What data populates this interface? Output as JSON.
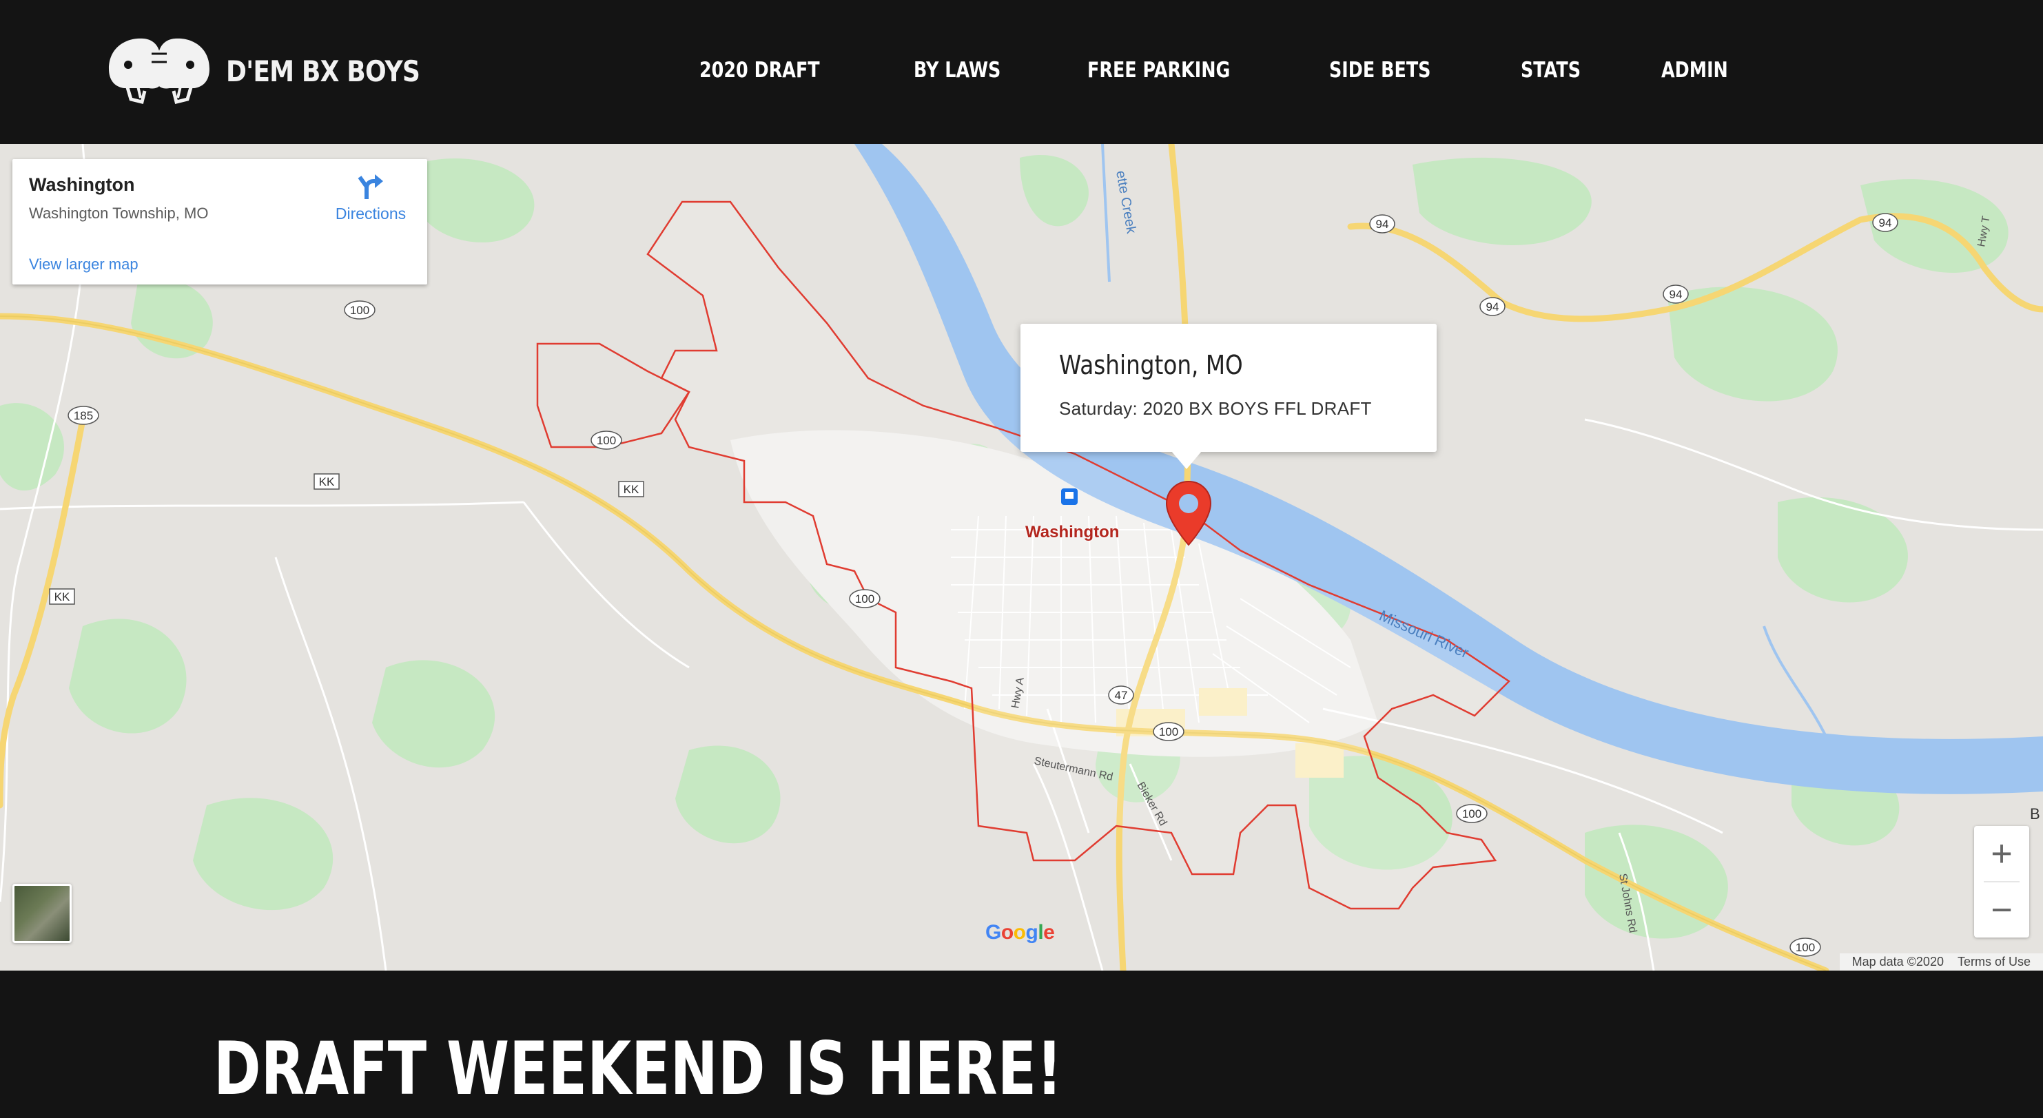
{
  "site": {
    "logo_text": "D'EM BX BOYS",
    "logo_icon": "football-helmets-icon"
  },
  "nav": [
    {
      "label": "2020 DRAFT"
    },
    {
      "label": "BY LAWS"
    },
    {
      "label": "FREE PARKING"
    },
    {
      "label": "SIDE BETS"
    },
    {
      "label": "STATS"
    },
    {
      "label": "ADMIN"
    }
  ],
  "map": {
    "place_card": {
      "name": "Washington",
      "address": "Washington Township, MO",
      "directions_label": "Directions",
      "larger_map_link": "View larger map"
    },
    "info_window": {
      "title": "Washington, MO",
      "subtitle": "Saturday: 2020 BX BOYS FFL DRAFT"
    },
    "city_label": "Washington",
    "river_label": "Missouri River",
    "creek_label": "ette Creek",
    "road_labels": [
      "Steutermann Rd",
      "Bieker Rd",
      "Hwy A",
      "St Johns Rd",
      "Hwy T"
    ],
    "route_shields": [
      "100",
      "100",
      "100",
      "100",
      "100",
      "100",
      "100",
      "185",
      "KK",
      "KK",
      "KK",
      "47",
      "94",
      "94",
      "94",
      "94"
    ],
    "edge_label": "B",
    "zoom": {
      "in": "+",
      "out": "−"
    },
    "google_logo": {
      "g": "G",
      "o1": "o",
      "o2": "o",
      "g2": "g",
      "l": "l",
      "e": "e"
    },
    "attribution": {
      "data": "Map data ©2020",
      "terms": "Terms of Use"
    },
    "colors": {
      "river": "#9fc5f0",
      "boundary": "#e03c31",
      "highway": "#f6d673",
      "park": "#c6e8c2",
      "land": "#e5e3df"
    }
  },
  "hero": {
    "headline": "DRAFT WEEKEND IS HERE!"
  }
}
